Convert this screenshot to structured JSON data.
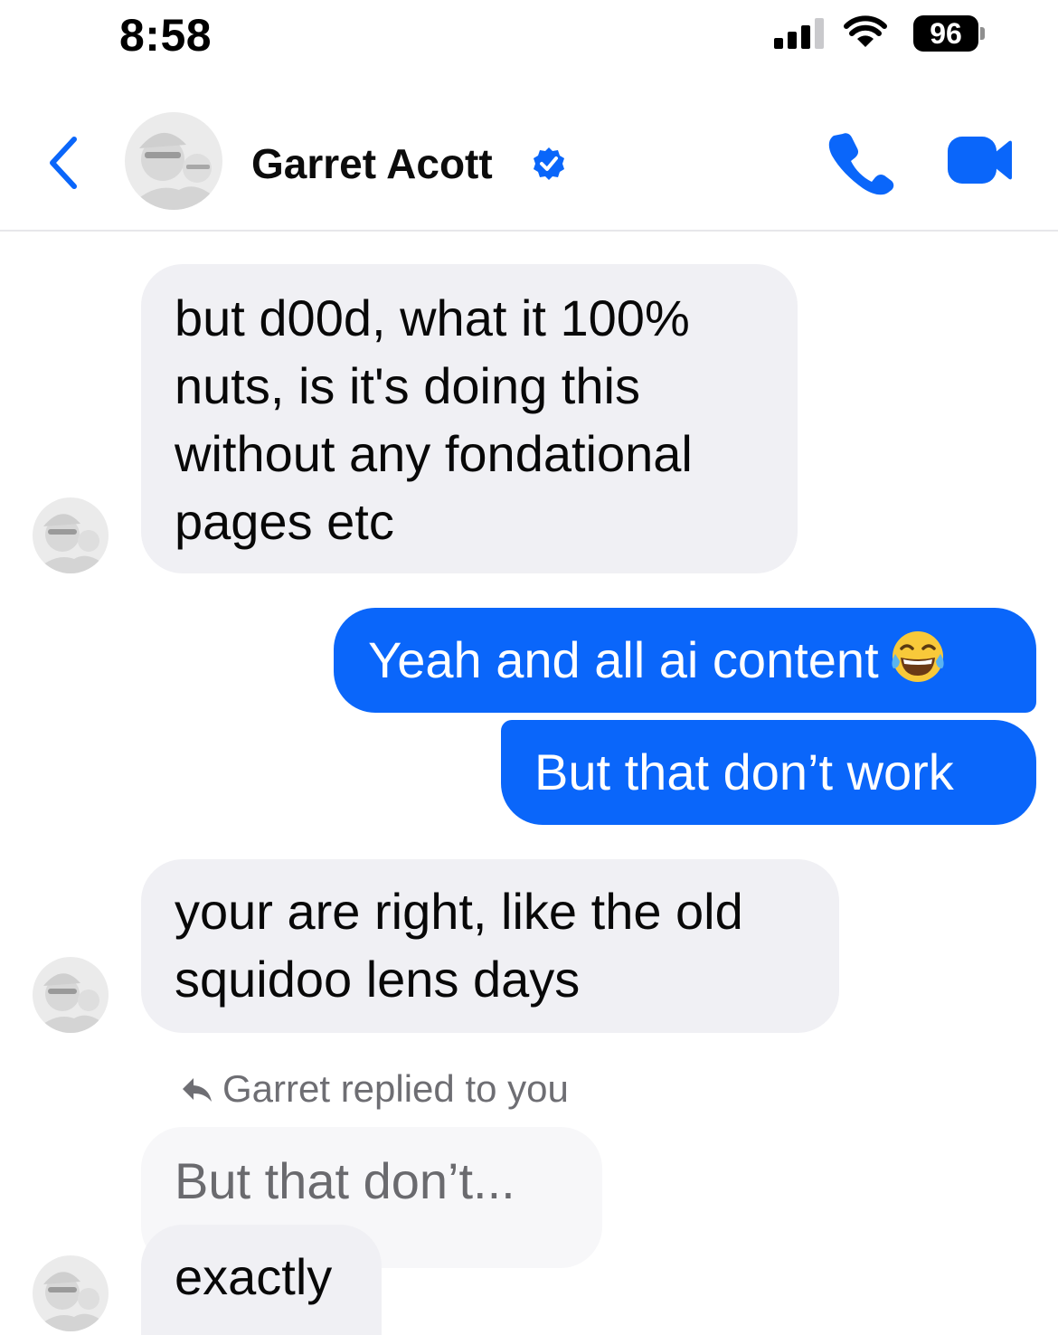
{
  "status_bar": {
    "time": "8:58",
    "battery": "96",
    "icons": [
      "cellular-signal-icon",
      "wifi-icon",
      "battery-icon"
    ]
  },
  "header": {
    "contact_name": "Garret Acott",
    "back_icon": "chevron-left-icon",
    "verified_icon": "verified-badge-icon",
    "call_icon": "phone-icon",
    "video_icon": "video-camera-icon"
  },
  "messages": [
    {
      "direction": "incoming",
      "lines": [
        "but d00d, what it 100%",
        "nuts, is it's doing this",
        "without any fondational",
        "pages etc"
      ]
    },
    {
      "direction": "outgoing",
      "text": "Yeah and all ai content",
      "emoji": "face-with-tears-of-joy"
    },
    {
      "direction": "outgoing",
      "text": "But that don’t work"
    },
    {
      "direction": "incoming",
      "lines": [
        "your are right, like the old",
        "squidoo lens days"
      ]
    },
    {
      "direction": "incoming",
      "reply_note": "Garret replied to you",
      "quoted_text": "But that don’t...",
      "text": "exactly"
    }
  ],
  "colors": {
    "accent": "#0a66fa",
    "incoming_bubble": "#f0f0f4",
    "outgoing_bubble": "#0a66fa",
    "muted_text": "#6e6e73"
  }
}
